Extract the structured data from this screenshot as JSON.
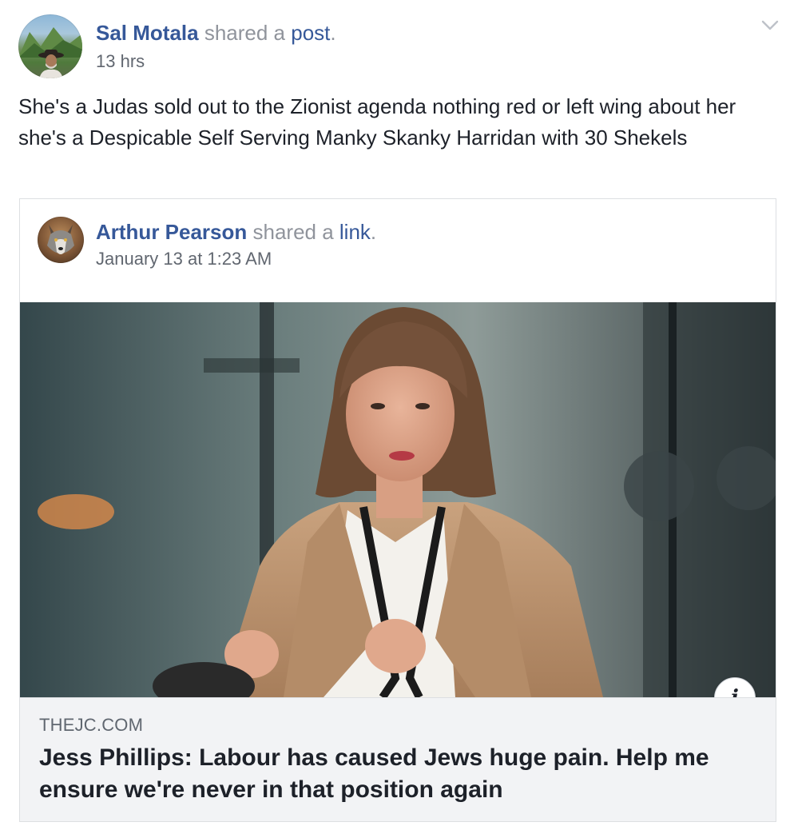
{
  "post": {
    "author": "Sal Motala",
    "action_prefix": " shared a ",
    "action_object": "post",
    "action_suffix": ".",
    "timestamp": "13 hrs",
    "text": "She's a Judas sold out to the Zionist agenda nothing red or left wing about her she's a Despicable Self Serving Manky Skanky Harridan with 30 Shekels",
    "menu_icon": "chevron-down-icon"
  },
  "shared": {
    "author": "Arthur Pearson",
    "action_prefix": " shared a ",
    "action_object": "link",
    "action_suffix": ".",
    "timestamp": "January 13 at 1:23 AM",
    "link": {
      "domain": "THEJC.COM",
      "title": "Jess Phillips: Labour has caused Jews huge pain. Help me ensure we're never in that position again",
      "info_icon": "info-icon",
      "info_glyph": "i"
    }
  },
  "colors": {
    "link_blue": "#365899",
    "meta_gray": "#90949c",
    "card_bg": "#f2f3f5"
  }
}
